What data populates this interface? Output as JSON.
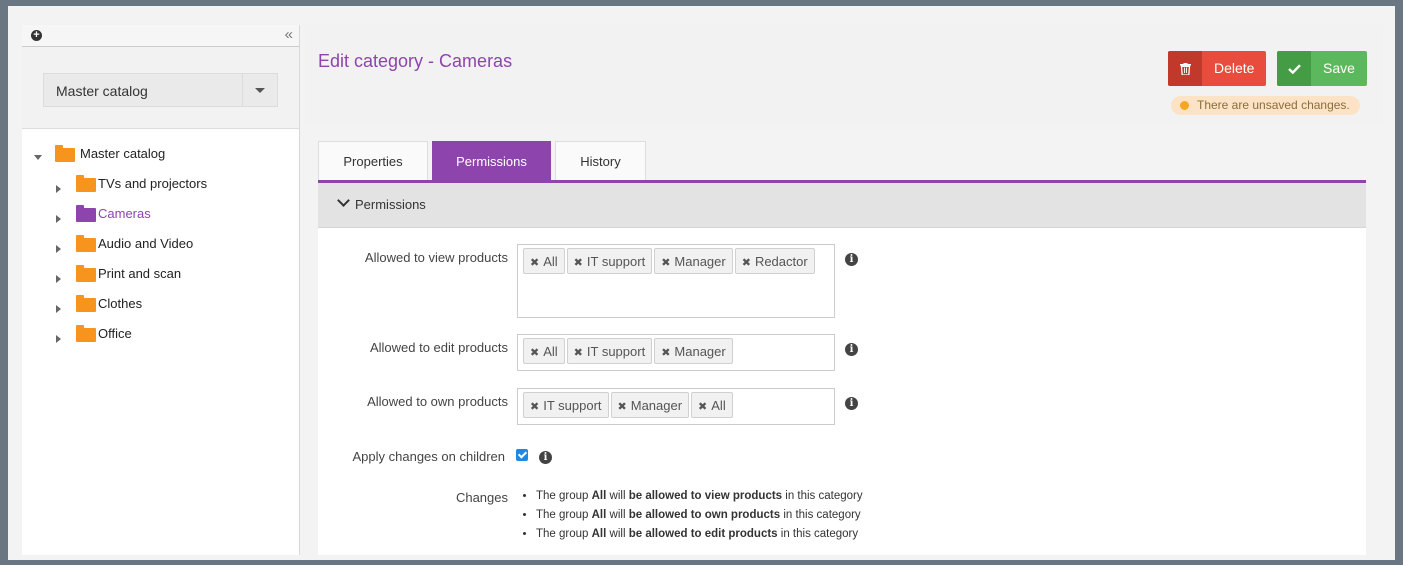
{
  "sidebar": {
    "catalog_select": "Master catalog",
    "tree": {
      "root": "Master catalog",
      "children": [
        {
          "label": "TVs and projectors",
          "selected": false
        },
        {
          "label": "Cameras",
          "selected": true
        },
        {
          "label": "Audio and Video",
          "selected": false
        },
        {
          "label": "Print and scan",
          "selected": false
        },
        {
          "label": "Clothes",
          "selected": false
        },
        {
          "label": "Office",
          "selected": false
        }
      ]
    }
  },
  "header": {
    "title": "Edit category - Cameras",
    "delete_label": "Delete",
    "save_label": "Save",
    "unsaved_notice": "There are unsaved changes."
  },
  "tabs": [
    {
      "label": "Properties",
      "active": false
    },
    {
      "label": "Permissions",
      "active": true
    },
    {
      "label": "History",
      "active": false
    }
  ],
  "panel": {
    "title": "Permissions",
    "fields": {
      "view": {
        "label": "Allowed to view products",
        "tags": [
          "All",
          "IT support",
          "Manager",
          "Redactor"
        ]
      },
      "edit": {
        "label": "Allowed to edit products",
        "tags": [
          "All",
          "IT support",
          "Manager"
        ]
      },
      "own": {
        "label": "Allowed to own products",
        "tags": [
          "IT support",
          "Manager",
          "All"
        ]
      }
    },
    "apply_children_label": "Apply changes on children",
    "apply_children_checked": true,
    "changes_label": "Changes",
    "changes": [
      {
        "pre": "The group ",
        "group": "All",
        "mid": " will ",
        "action": "be allowed to view products",
        "post": " in this category"
      },
      {
        "pre": "The group ",
        "group": "All",
        "mid": " will ",
        "action": "be allowed to own products",
        "post": " in this category"
      },
      {
        "pre": "The group ",
        "group": "All",
        "mid": " will ",
        "action": "be allowed to edit products",
        "post": " in this category"
      }
    ]
  },
  "colors": {
    "accent": "#8e44ad",
    "folder": "#f7941d",
    "folder_selected": "#8e44ad",
    "delete": "#e74c3c",
    "save": "#5cb85c",
    "warning": "#f5a623"
  }
}
